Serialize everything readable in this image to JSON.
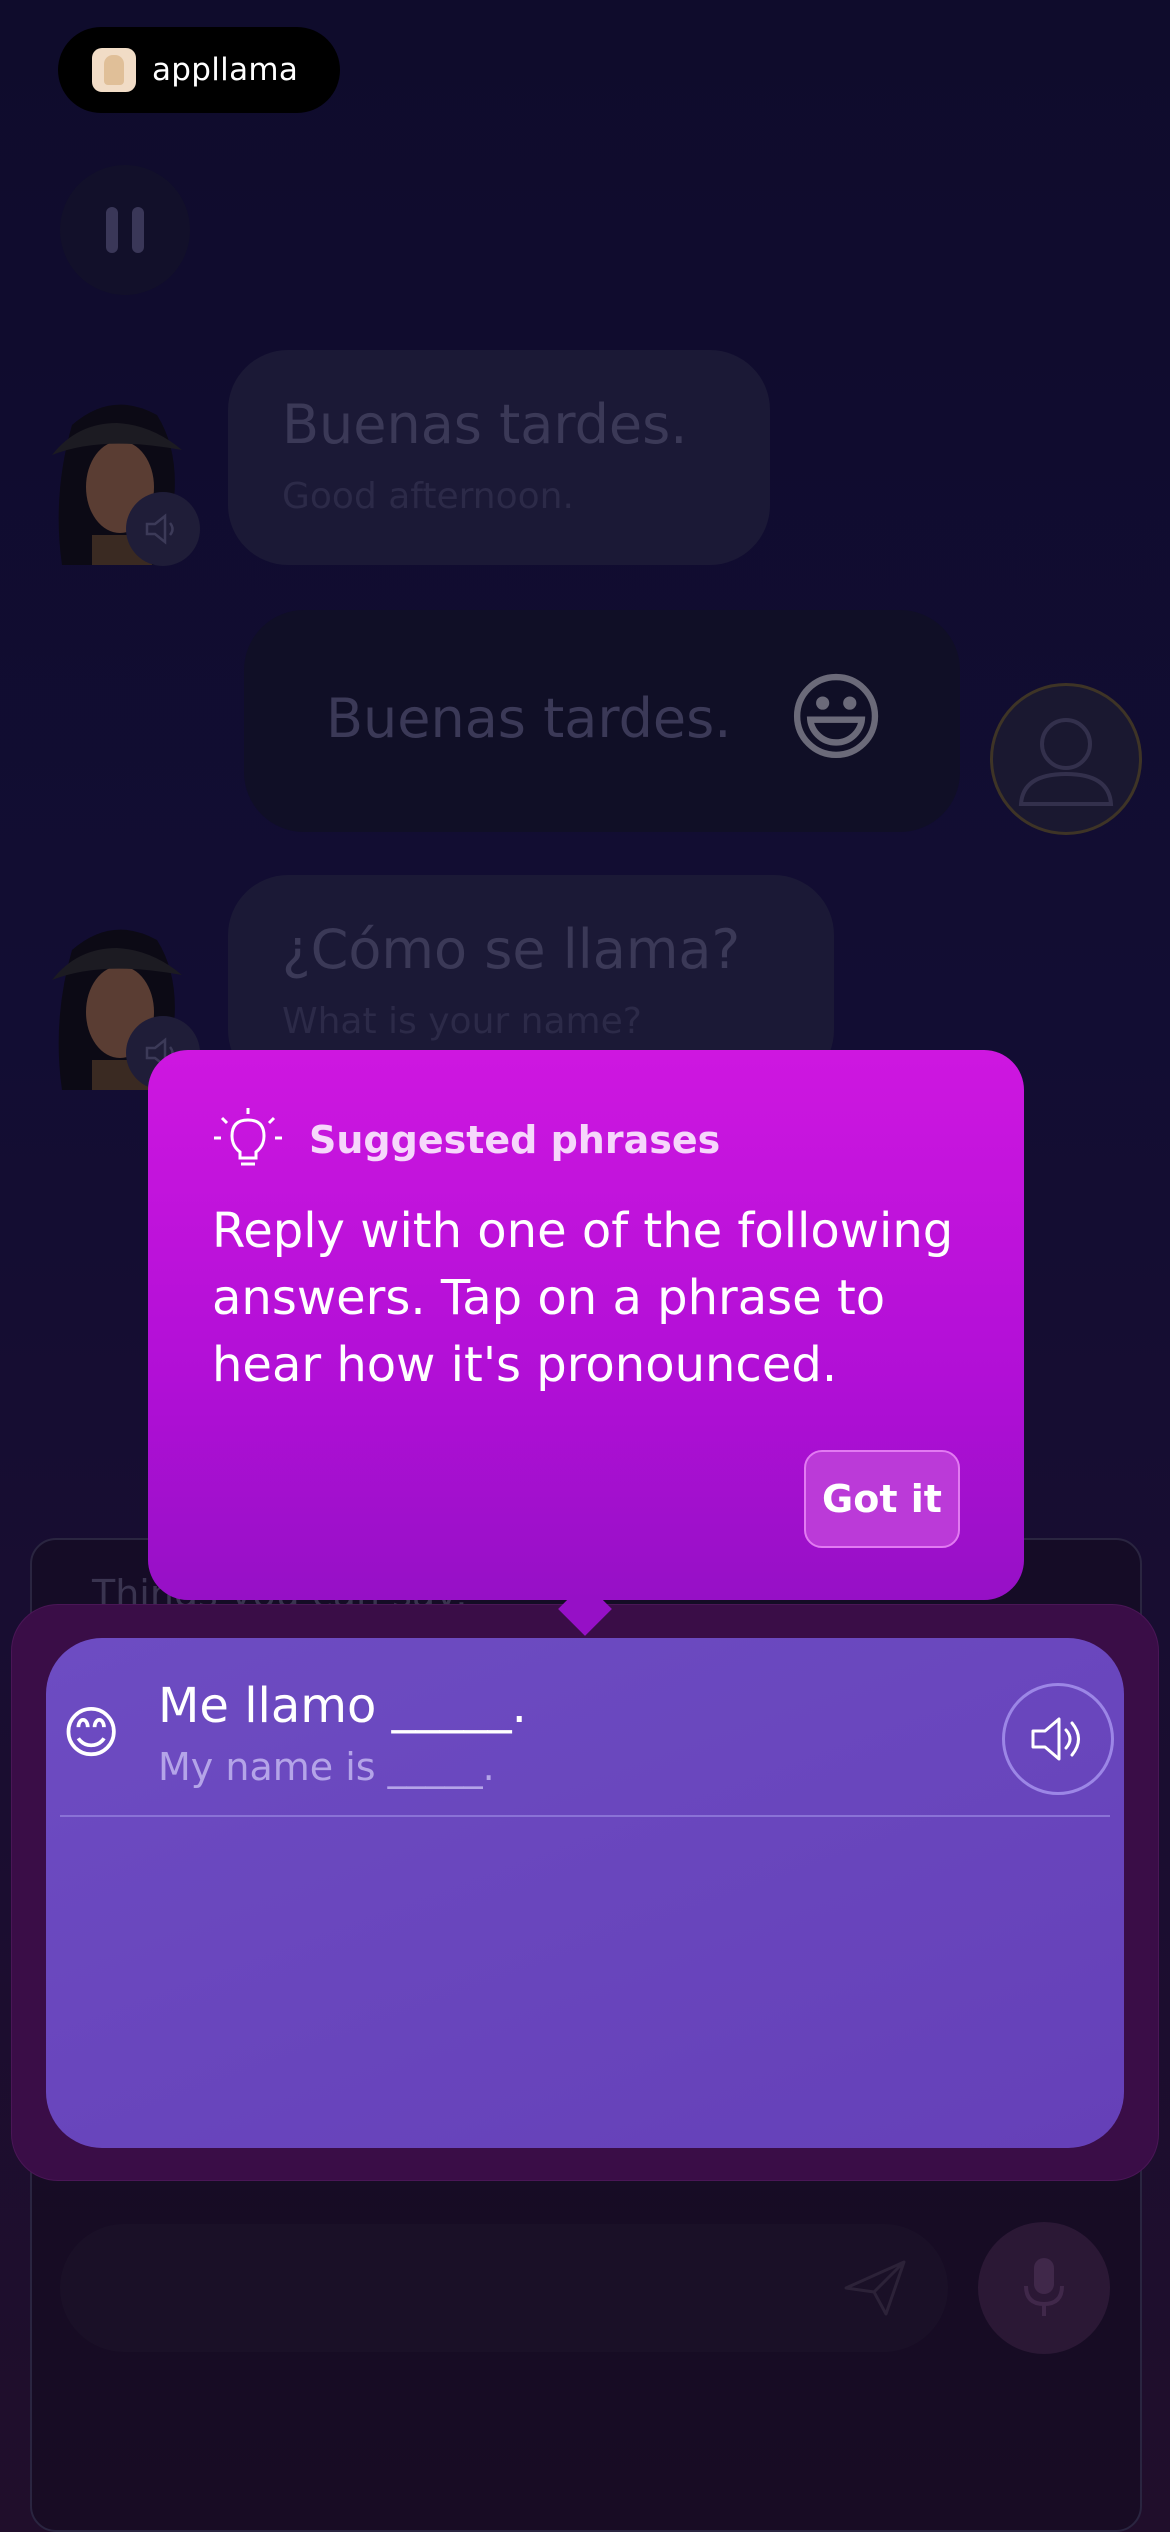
{
  "app": {
    "logo_text": "appllama"
  },
  "messages": [
    {
      "speaker": "tutor",
      "text": "Buenas tardes.",
      "translation": "Good afternoon."
    },
    {
      "speaker": "user",
      "text": "Buenas tardes.",
      "emoji": "😃"
    },
    {
      "speaker": "tutor",
      "text": "¿Cómo se llama?",
      "translation": "What is your name?"
    }
  ],
  "suggestions_panel": {
    "hint": "Things you can say:",
    "phrases": [
      {
        "emoji": "😊",
        "text": "Me llamo _____.",
        "translation": "My name is _____."
      }
    ]
  },
  "tooltip": {
    "title": "Suggested phrases",
    "body": "Reply with one of the following answers. Tap on a phrase to hear how it's pronounced.",
    "button": "Got it"
  },
  "icons": {
    "pause": "pause-icon",
    "speaker": "speaker-icon",
    "user": "user-icon",
    "send": "send-icon",
    "mic": "microphone-icon",
    "lightbulb": "lightbulb-icon"
  },
  "colors": {
    "tooltip": "#c214df",
    "phrase_card": "#6a46be",
    "background": "#120d33"
  }
}
